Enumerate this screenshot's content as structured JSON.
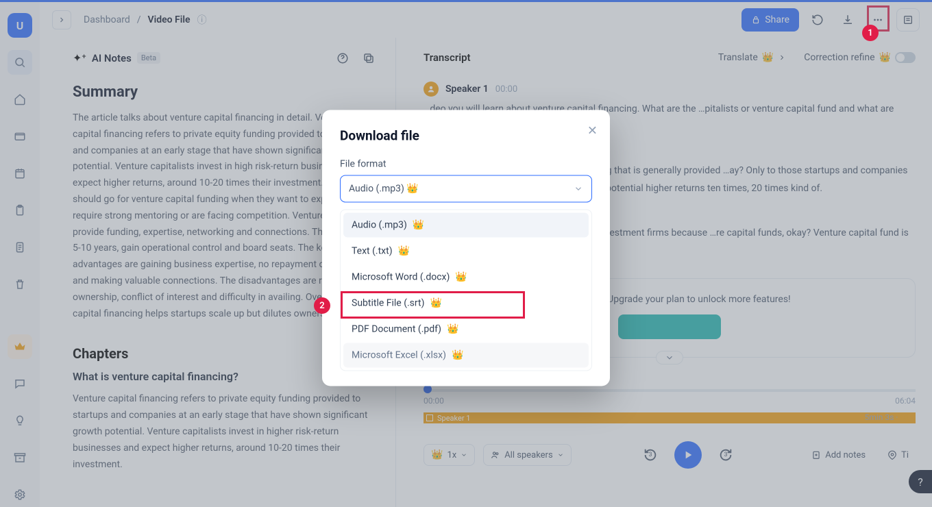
{
  "sidebar": {
    "avatar_letter": "U"
  },
  "breadcrumbs": {
    "root": "Dashboard",
    "sep": "/",
    "current": "Video File"
  },
  "header": {
    "share_label": "Share"
  },
  "left": {
    "title": "AI Notes",
    "badge": "Beta",
    "summary_heading": "Summary",
    "summary_body": "The article talks about venture capital financing in detail. Venture capital financing refers to private equity funding provided to startups and companies at an early stage that have shown significant growth potential. Venture capitalists invest in high risk-return businesses and expect higher returns, around 10-20 times their investment. Companies should go for venture capital funding when they want to expand, require strong mentoring or are facing competition. Venture capitalists provide funding, expertise, networking and connections. They invest for 5-10 years, gain operational control and board seats. The key advantages are gaining business expertise, no repayment obligation and making valuable connections. The disadvantages are reduced ownership, conflict of interest and difficulty in availing. Overall, venture capital financing helps startups scale up but dilutes ownership.",
    "chapters_heading": "Chapters",
    "chapter1_title": "What is venture capital financing?",
    "chapter1_body": "Venture capital financing refers to private equity funding provided to startups and companies at an early stage that have shown significant growth potential. Venture capitalists invest in higher risk-return businesses and expect higher returns, around 10-20 times their investment."
  },
  "right": {
    "title": "Transcript",
    "translate": "Translate",
    "correction": "Correction refine",
    "speaker1": "Speaker 1",
    "ts1": "00:00",
    "line1": "…deo you will learn about venture capital financing. What are the …pitalists or venture capital fund and what are disadvantages, what are",
    "line2": "…capital financing is a private equity funding that is generally provided …ay? Only to those startups and companies who have shown their … that they can earn potential higher returns ten times, 20 times kind of.",
    "line3": "…f investors who come together through investment firms because …re capital funds, okay? Venture capital fund is a pool of money which",
    "upgrade_text": "…n Free Plan. Upgrade your plan to unlock more features!",
    "t_start": "00:00",
    "t_end": "06:04",
    "bar_label": "Speaker 1",
    "dur_text": "5min 3s",
    "dur_pct": "83%",
    "speed": "1x",
    "all_speakers": "All speakers",
    "skip": "3",
    "add_notes": "Add notes",
    "ti": "Ti"
  },
  "modal": {
    "title": "Download file",
    "file_format_label": "File format",
    "selected": "Audio (.mp3)",
    "options": [
      "Audio (.mp3)",
      "Text (.txt)",
      "Microsoft Word (.docx)",
      "Subtitle File (.srt)",
      "PDF Document (.pdf)",
      "Microsoft Excel (.xlsx)"
    ]
  },
  "badges": {
    "n1": "1",
    "n2": "2"
  }
}
